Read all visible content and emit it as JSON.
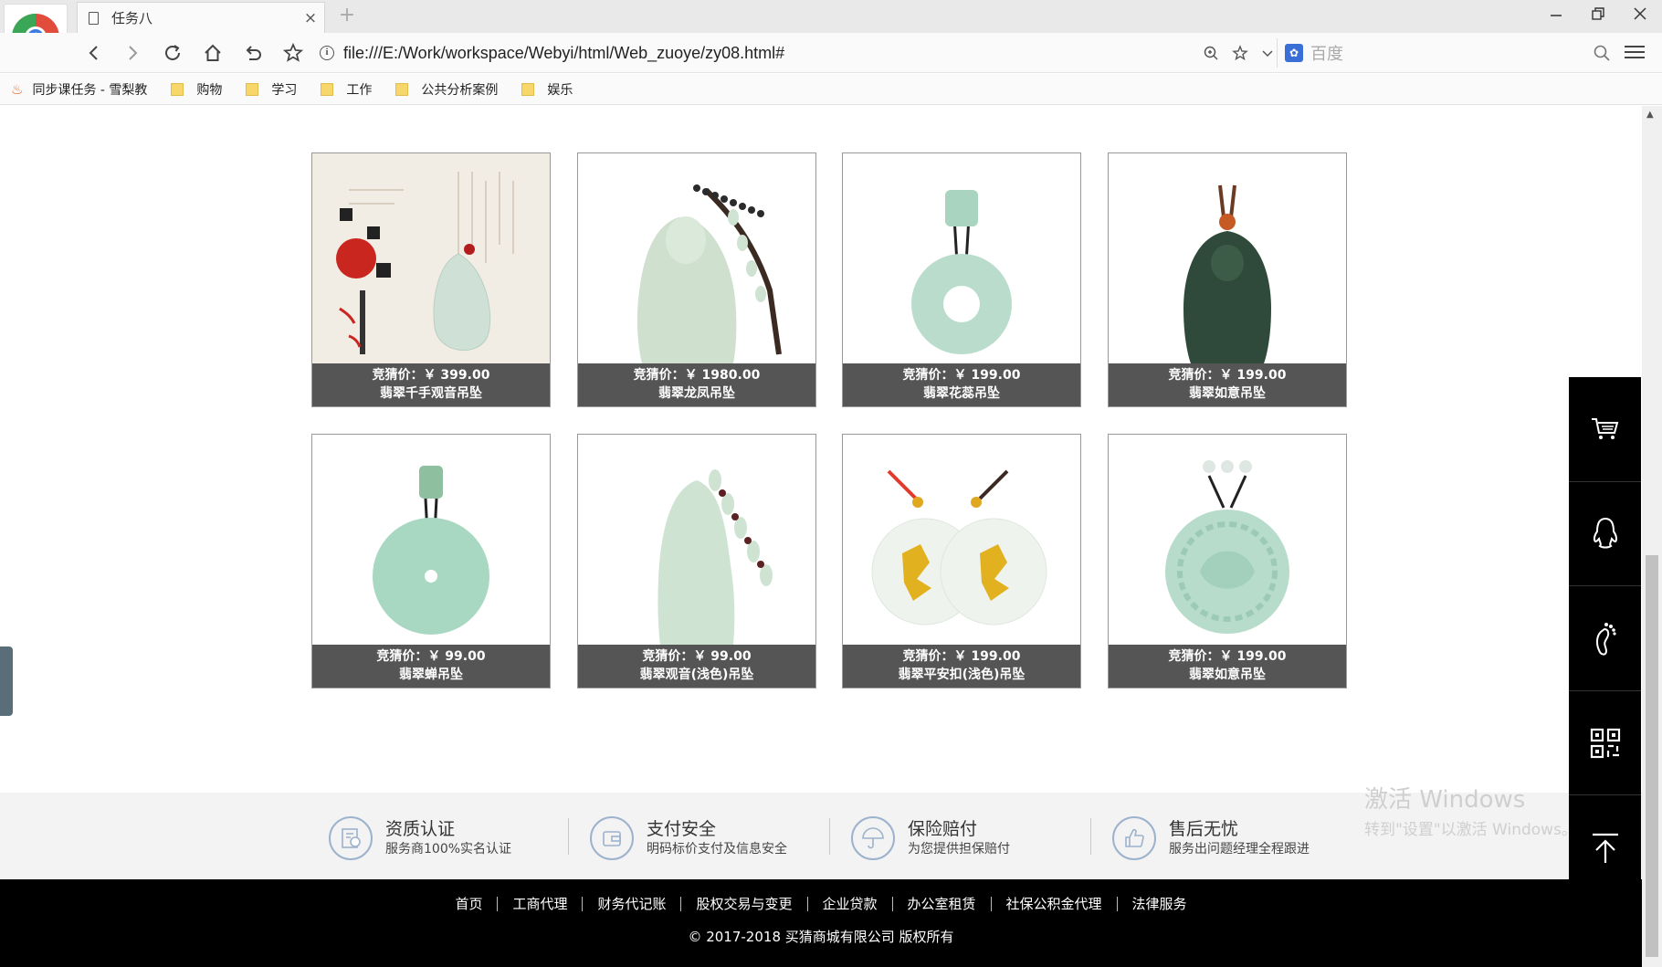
{
  "browser": {
    "tab_title": "任务八",
    "tab_close": "×",
    "new_tab": "+",
    "url": "file:///E:/Work/workspace/Webyi/html/Web_zuoye/zy08.html#",
    "search_placeholder": "百度",
    "bookmarks": [
      {
        "label": "同步课任务 - 雪梨教"
      },
      {
        "label": "购物"
      },
      {
        "label": "学习"
      },
      {
        "label": "工作"
      },
      {
        "label": "公共分析案例"
      },
      {
        "label": "娱乐"
      }
    ]
  },
  "products": [
    {
      "price": "竞猜价：￥ 399.00",
      "name": "翡翠千手观音吊坠",
      "jade": "#cfe1d6",
      "shape": "guanyin-art"
    },
    {
      "price": "竞猜价：￥ 1980.00",
      "name": "翡翠龙凤吊坠",
      "jade": "#cfe0cf",
      "shape": "buddha"
    },
    {
      "price": "竞猜价：￥ 199.00",
      "name": "翡翠花蕊吊坠",
      "jade": "#b9dccd",
      "shape": "donut"
    },
    {
      "price": "竞猜价：￥ 199.00",
      "name": "翡翠如意吊坠",
      "jade": "#2f4a3a",
      "shape": "dark-buddha"
    },
    {
      "price": "竞猜价：￥ 99.00",
      "name": "翡翠蝉吊坠",
      "jade": "#a9d8c2",
      "shape": "disc"
    },
    {
      "price": "竞猜价：￥ 99.00",
      "name": "翡翠观音(浅色)吊坠",
      "jade": "#cfe3d3",
      "shape": "guanyin"
    },
    {
      "price": "竞猜价：￥ 199.00",
      "name": "翡翠平安扣(浅色)吊坠",
      "jade": "#eef3ee",
      "shape": "pair"
    },
    {
      "price": "竞猜价：￥ 199.00",
      "name": "翡翠如意吊坠",
      "jade": "#b7dccb",
      "shape": "dragon"
    }
  ],
  "services": [
    {
      "title": "资质认证",
      "sub": "服务商100%实名认证",
      "icon": "certificate-icon"
    },
    {
      "title": "支付安全",
      "sub": "明码标价支付及信息安全",
      "icon": "wallet-icon"
    },
    {
      "title": "保险赔付",
      "sub": "为您提供担保赔付",
      "icon": "umbrella-icon"
    },
    {
      "title": "售后无忧",
      "sub": "服务出问题经理全程跟进",
      "icon": "thumbs-up-icon"
    }
  ],
  "footer": {
    "links": [
      "首页",
      "工商代理",
      "财务代记账",
      "股权交易与变更",
      "企业贷款",
      "办公室租赁",
      "社保公积金代理",
      "法律服务"
    ],
    "copyright": "©  2017-2018  买猜商城有限公司  版权所有"
  },
  "watermark": {
    "line1": "激活 Windows",
    "line2": "转到\"设置\"以激活 Windows。"
  },
  "sidebar": [
    "cart-icon",
    "qq-icon",
    "footprint-icon",
    "qrcode-icon",
    "back-to-top-icon"
  ]
}
